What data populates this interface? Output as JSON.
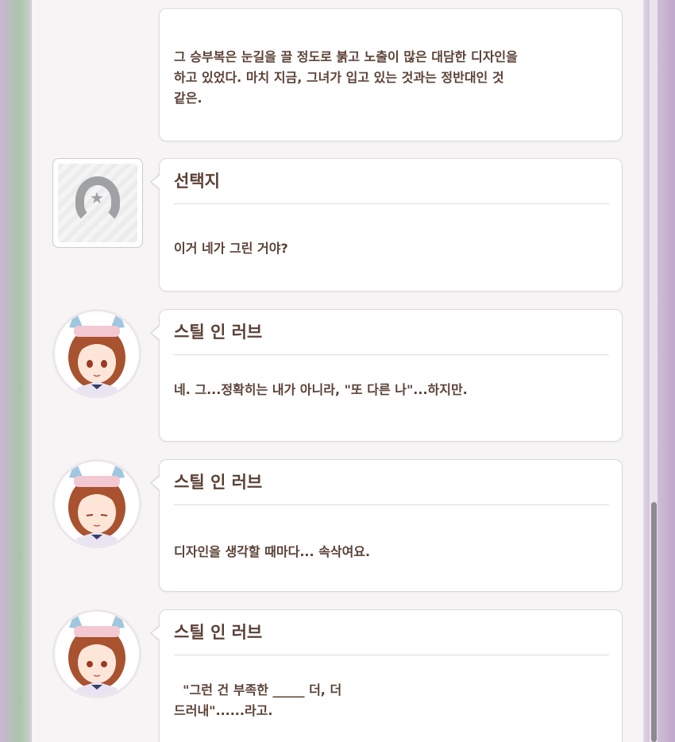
{
  "messages": [
    {
      "speaker": "",
      "lines": [
        "그 승부복은 눈길을 끌 정도로 붉고 노출이 많은 대담한 디자인을",
        "하고 있었다. 마치 지금, 그녀가 입고 있는 것과는 정반대인 것",
        "같은."
      ]
    },
    {
      "speaker": "선택지",
      "lines": [
        "이거 네가 그린 거야?"
      ],
      "avatar_icon": "horseshoe-icon"
    },
    {
      "speaker": "스틸 인 러브",
      "lines": [
        "네. 그...정확히는 내가 아니라, \"또 다른 나\"...하지만."
      ]
    },
    {
      "speaker": "스틸 인 러브",
      "lines": [
        "디자인을 생각할 때마다... 속삭여요."
      ]
    },
    {
      "speaker": "스틸 인 러브",
      "lines": [
        "  \"그런 건 부족한 _____ 더, 더",
        "드러내\"......라고."
      ]
    }
  ],
  "colors": {
    "text": "#5b4136",
    "bubble_border": "#ddd9dc",
    "hair": "#a8522f",
    "ear": "#9fc7e0"
  }
}
